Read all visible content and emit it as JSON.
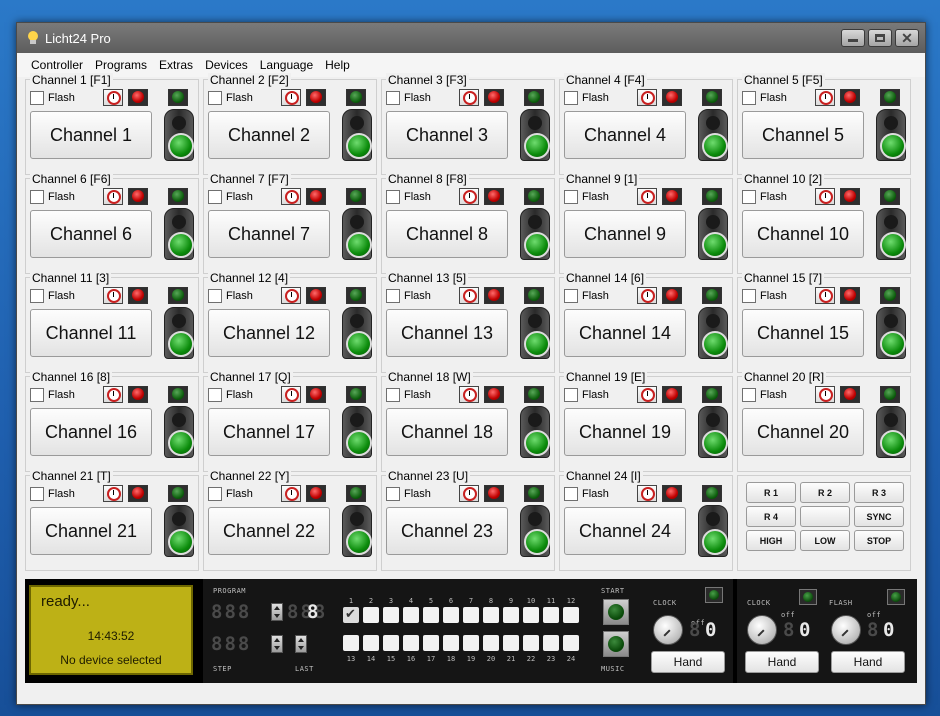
{
  "window": {
    "title": "Licht24 Pro"
  },
  "menu": [
    "Controller",
    "Programs",
    "Extras",
    "Devices",
    "Language",
    "Help"
  ],
  "channels": [
    {
      "legend": "Channel 1 [F1]",
      "label": "Channel 1"
    },
    {
      "legend": "Channel 2 [F2]",
      "label": "Channel 2"
    },
    {
      "legend": "Channel 3 [F3]",
      "label": "Channel 3"
    },
    {
      "legend": "Channel 4 [F4]",
      "label": "Channel 4"
    },
    {
      "legend": "Channel 5 [F5]",
      "label": "Channel 5"
    },
    {
      "legend": "Channel 6 [F6]",
      "label": "Channel 6"
    },
    {
      "legend": "Channel 7 [F7]",
      "label": "Channel 7"
    },
    {
      "legend": "Channel 8 [F8]",
      "label": "Channel 8"
    },
    {
      "legend": "Channel 9 [1]",
      "label": "Channel 9"
    },
    {
      "legend": "Channel 10 [2]",
      "label": "Channel 10"
    },
    {
      "legend": "Channel 11 [3]",
      "label": "Channel 11"
    },
    {
      "legend": "Channel 12 [4]",
      "label": "Channel 12"
    },
    {
      "legend": "Channel 13 [5]",
      "label": "Channel 13"
    },
    {
      "legend": "Channel 14 [6]",
      "label": "Channel 14"
    },
    {
      "legend": "Channel 15 [7]",
      "label": "Channel 15"
    },
    {
      "legend": "Channel 16 [8]",
      "label": "Channel 16"
    },
    {
      "legend": "Channel 17 [Q]",
      "label": "Channel 17"
    },
    {
      "legend": "Channel 18 [W]",
      "label": "Channel 18"
    },
    {
      "legend": "Channel 19 [E]",
      "label": "Channel 19"
    },
    {
      "legend": "Channel 20 [R]",
      "label": "Channel 20"
    },
    {
      "legend": "Channel 21 [T]",
      "label": "Channel 21"
    },
    {
      "legend": "Channel 22 [Y]",
      "label": "Channel 22"
    },
    {
      "legend": "Channel 23 [U]",
      "label": "Channel 23"
    },
    {
      "legend": "Channel 24 [I]",
      "label": "Channel 24"
    }
  ],
  "flash_label": "Flash",
  "random_buttons": {
    "r1": "R 1",
    "r2": "R 2",
    "r3": "R 3",
    "r4": "R 4",
    "blank": "",
    "sync": "SYNC",
    "high": "HIGH",
    "low": "LOW",
    "stop": "STOP"
  },
  "status": {
    "line1": "ready...",
    "time": "14:43:52",
    "device": "No device selected"
  },
  "sequencer": {
    "program_label": "PROGRAM",
    "step_label": "STEP",
    "last_label": "LAST",
    "start_label": "START",
    "music_label": "MUSIC",
    "clock_label": "CLOCK",
    "off_label": "off",
    "program_digits": "888",
    "program_value": "8",
    "step_digits": "888",
    "clock_digits": "8",
    "clock_value": "0",
    "top_numbers": [
      "1",
      "2",
      "3",
      "4",
      "5",
      "6",
      "7",
      "8",
      "9",
      "10",
      "11",
      "12"
    ],
    "bottom_numbers": [
      "13",
      "14",
      "15",
      "16",
      "17",
      "18",
      "19",
      "20",
      "21",
      "22",
      "23",
      "24"
    ],
    "hand_label": "Hand"
  },
  "right": {
    "clock_label": "CLOCK",
    "flash_label": "FLASH",
    "off_label": "off",
    "clock_digits": "8",
    "clock_value": "0",
    "flash_digits": "8",
    "flash_value": "0",
    "hand_label_1": "Hand",
    "hand_label_2": "Hand"
  }
}
